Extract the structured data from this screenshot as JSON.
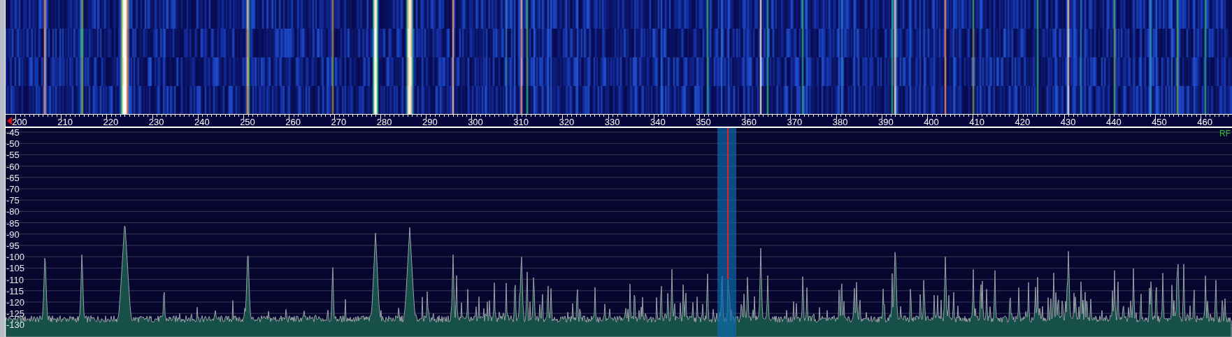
{
  "frequency_axis": {
    "labels": [
      "200",
      "210",
      "220",
      "230",
      "240",
      "250",
      "260",
      "270",
      "280",
      "290",
      "300",
      "310",
      "320",
      "330",
      "340",
      "350",
      "360",
      "370",
      "380",
      "390",
      "400",
      "410",
      "420",
      "430",
      "440",
      "450",
      "460"
    ]
  },
  "spectrum": {
    "level_labels": [
      "-45",
      "-50",
      "-55",
      "-60",
      "-65",
      "-70",
      "-75",
      "-80",
      "-85",
      "-90",
      "-95",
      "-100",
      "-105",
      "-110",
      "-115",
      "-120",
      "-125",
      "-130"
    ],
    "mode_label": "RF"
  }
}
